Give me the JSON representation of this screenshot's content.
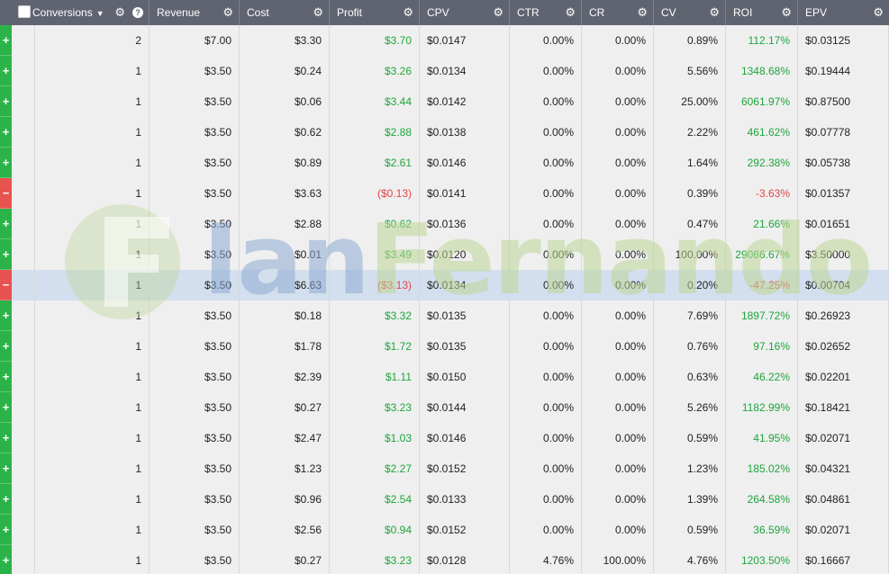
{
  "header": {
    "conversions": "Conversions",
    "revenue": "Revenue",
    "cost": "Cost",
    "profit": "Profit",
    "cpv": "CPV",
    "ctr": "CTR",
    "cr": "CR",
    "cv": "CV",
    "roi": "ROI",
    "epv": "EPV",
    "gear_icon": "gear-icon",
    "help_icon": "help-icon",
    "caret_icon": "chevron-down-icon"
  },
  "watermark": {
    "part1": "Ian",
    "part2": "Fernando"
  },
  "colors": {
    "positive": "#1ea63c",
    "negative": "#e04646",
    "plus_marker": "#2bb34a",
    "minus_marker": "#e8524f",
    "header_bg": "#5f6470",
    "highlight_row": "#d3dfee"
  },
  "rows": [
    {
      "marker": "+",
      "conv": "2",
      "rev": "$7.00",
      "cost": "$3.30",
      "profit": "$3.70",
      "cpv": "$0.0147",
      "ctr": "0.00%",
      "cr": "0.00%",
      "cv": "0.89%",
      "roi": "112.17%",
      "epv": "$0.03125",
      "neg": false
    },
    {
      "marker": "+",
      "conv": "1",
      "rev": "$3.50",
      "cost": "$0.24",
      "profit": "$3.26",
      "cpv": "$0.0134",
      "ctr": "0.00%",
      "cr": "0.00%",
      "cv": "5.56%",
      "roi": "1348.68%",
      "epv": "$0.19444",
      "neg": false
    },
    {
      "marker": "+",
      "conv": "1",
      "rev": "$3.50",
      "cost": "$0.06",
      "profit": "$3.44",
      "cpv": "$0.0142",
      "ctr": "0.00%",
      "cr": "0.00%",
      "cv": "25.00%",
      "roi": "6061.97%",
      "epv": "$0.87500",
      "neg": false
    },
    {
      "marker": "+",
      "conv": "1",
      "rev": "$3.50",
      "cost": "$0.62",
      "profit": "$2.88",
      "cpv": "$0.0138",
      "ctr": "0.00%",
      "cr": "0.00%",
      "cv": "2.22%",
      "roi": "461.62%",
      "epv": "$0.07778",
      "neg": false
    },
    {
      "marker": "+",
      "conv": "1",
      "rev": "$3.50",
      "cost": "$0.89",
      "profit": "$2.61",
      "cpv": "$0.0146",
      "ctr": "0.00%",
      "cr": "0.00%",
      "cv": "1.64%",
      "roi": "292.38%",
      "epv": "$0.05738",
      "neg": false
    },
    {
      "marker": "−",
      "conv": "1",
      "rev": "$3.50",
      "cost": "$3.63",
      "profit": "($0.13)",
      "cpv": "$0.0141",
      "ctr": "0.00%",
      "cr": "0.00%",
      "cv": "0.39%",
      "roi": "-3.63%",
      "epv": "$0.01357",
      "neg": true
    },
    {
      "marker": "+",
      "conv": "1",
      "rev": "$3.50",
      "cost": "$2.88",
      "profit": "$0.62",
      "cpv": "$0.0136",
      "ctr": "0.00%",
      "cr": "0.00%",
      "cv": "0.47%",
      "roi": "21.66%",
      "epv": "$0.01651",
      "neg": false
    },
    {
      "marker": "+",
      "conv": "1",
      "rev": "$3.50",
      "cost": "$0.01",
      "profit": "$3.49",
      "cpv": "$0.0120",
      "ctr": "0.00%",
      "cr": "0.00%",
      "cv": "100.00%",
      "roi": "29066.67%",
      "epv": "$3.50000",
      "neg": false
    },
    {
      "marker": "−",
      "conv": "1",
      "rev": "$3.50",
      "cost": "$6.63",
      "profit": "($3.13)",
      "cpv": "$0.0134",
      "ctr": "0.00%",
      "cr": "0.00%",
      "cv": "0.20%",
      "roi": "-47.25%",
      "epv": "$0.00704",
      "neg": true,
      "highlight": true
    },
    {
      "marker": "+",
      "conv": "1",
      "rev": "$3.50",
      "cost": "$0.18",
      "profit": "$3.32",
      "cpv": "$0.0135",
      "ctr": "0.00%",
      "cr": "0.00%",
      "cv": "7.69%",
      "roi": "1897.72%",
      "epv": "$0.26923",
      "neg": false
    },
    {
      "marker": "+",
      "conv": "1",
      "rev": "$3.50",
      "cost": "$1.78",
      "profit": "$1.72",
      "cpv": "$0.0135",
      "ctr": "0.00%",
      "cr": "0.00%",
      "cv": "0.76%",
      "roi": "97.16%",
      "epv": "$0.02652",
      "neg": false
    },
    {
      "marker": "+",
      "conv": "1",
      "rev": "$3.50",
      "cost": "$2.39",
      "profit": "$1.11",
      "cpv": "$0.0150",
      "ctr": "0.00%",
      "cr": "0.00%",
      "cv": "0.63%",
      "roi": "46.22%",
      "epv": "$0.02201",
      "neg": false
    },
    {
      "marker": "+",
      "conv": "1",
      "rev": "$3.50",
      "cost": "$0.27",
      "profit": "$3.23",
      "cpv": "$0.0144",
      "ctr": "0.00%",
      "cr": "0.00%",
      "cv": "5.26%",
      "roi": "1182.99%",
      "epv": "$0.18421",
      "neg": false
    },
    {
      "marker": "+",
      "conv": "1",
      "rev": "$3.50",
      "cost": "$2.47",
      "profit": "$1.03",
      "cpv": "$0.0146",
      "ctr": "0.00%",
      "cr": "0.00%",
      "cv": "0.59%",
      "roi": "41.95%",
      "epv": "$0.02071",
      "neg": false
    },
    {
      "marker": "+",
      "conv": "1",
      "rev": "$3.50",
      "cost": "$1.23",
      "profit": "$2.27",
      "cpv": "$0.0152",
      "ctr": "0.00%",
      "cr": "0.00%",
      "cv": "1.23%",
      "roi": "185.02%",
      "epv": "$0.04321",
      "neg": false
    },
    {
      "marker": "+",
      "conv": "1",
      "rev": "$3.50",
      "cost": "$0.96",
      "profit": "$2.54",
      "cpv": "$0.0133",
      "ctr": "0.00%",
      "cr": "0.00%",
      "cv": "1.39%",
      "roi": "264.58%",
      "epv": "$0.04861",
      "neg": false
    },
    {
      "marker": "+",
      "conv": "1",
      "rev": "$3.50",
      "cost": "$2.56",
      "profit": "$0.94",
      "cpv": "$0.0152",
      "ctr": "0.00%",
      "cr": "0.00%",
      "cv": "0.59%",
      "roi": "36.59%",
      "epv": "$0.02071",
      "neg": false
    },
    {
      "marker": "+",
      "conv": "1",
      "rev": "$3.50",
      "cost": "$0.27",
      "profit": "$3.23",
      "cpv": "$0.0128",
      "ctr": "4.76%",
      "cr": "100.00%",
      "cv": "4.76%",
      "roi": "1203.50%",
      "epv": "$0.16667",
      "neg": false
    }
  ]
}
